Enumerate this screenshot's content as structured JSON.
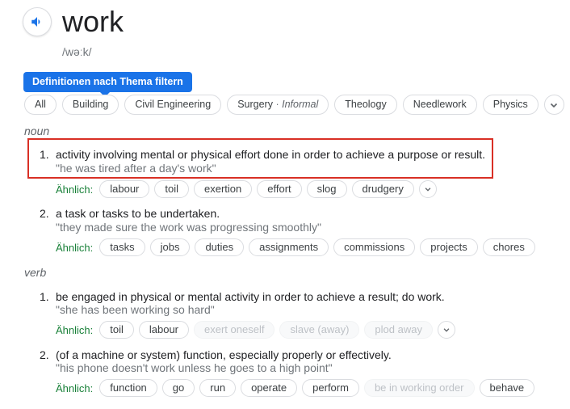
{
  "entry": {
    "word": "work",
    "phonetic": "/wəːk/"
  },
  "tooltip": "Definitionen nach Thema filtern",
  "filters": [
    "All",
    "Building",
    "Civil Engineering",
    "Theology",
    "Needlework",
    "Physics"
  ],
  "surgery": {
    "label": "Surgery",
    "sep": "·",
    "register": "Informal"
  },
  "similar_label": "Ähnlich:",
  "noun": {
    "label": "noun",
    "senses": [
      {
        "num": "1.",
        "definition": "activity involving mental or physical effort done in order to achieve a purpose or result.",
        "example": "\"he was tired after a day's work\"",
        "synonyms": [
          "labour",
          "toil",
          "exertion",
          "effort",
          "slog",
          "drudgery"
        ]
      },
      {
        "num": "2.",
        "definition": "a task or tasks to be undertaken.",
        "example": "\"they made sure the work was progressing smoothly\"",
        "synonyms": [
          "tasks",
          "jobs",
          "duties",
          "assignments",
          "commissions",
          "projects",
          "chores"
        ]
      }
    ]
  },
  "verb": {
    "label": "verb",
    "senses": [
      {
        "num": "1.",
        "definition": "be engaged in physical or mental activity in order to achieve a result; do work.",
        "example": "\"she has been working so hard\"",
        "synonyms": [
          "toil",
          "labour"
        ],
        "dim_synonyms": [
          "exert oneself",
          "slave (away)",
          "plod away"
        ]
      },
      {
        "num": "2.",
        "definition": "(of a machine or system) function, especially properly or effectively.",
        "example": "\"his phone doesn't work unless he goes to a high point\"",
        "synonyms": [
          "function",
          "go",
          "run",
          "operate",
          "perform"
        ],
        "dim_synonyms": [
          "be in working order"
        ],
        "last_synonym": "behave"
      }
    ]
  },
  "colors": {
    "accent": "#1a73e8",
    "highlight": "#d93025",
    "similar": "#188038"
  }
}
